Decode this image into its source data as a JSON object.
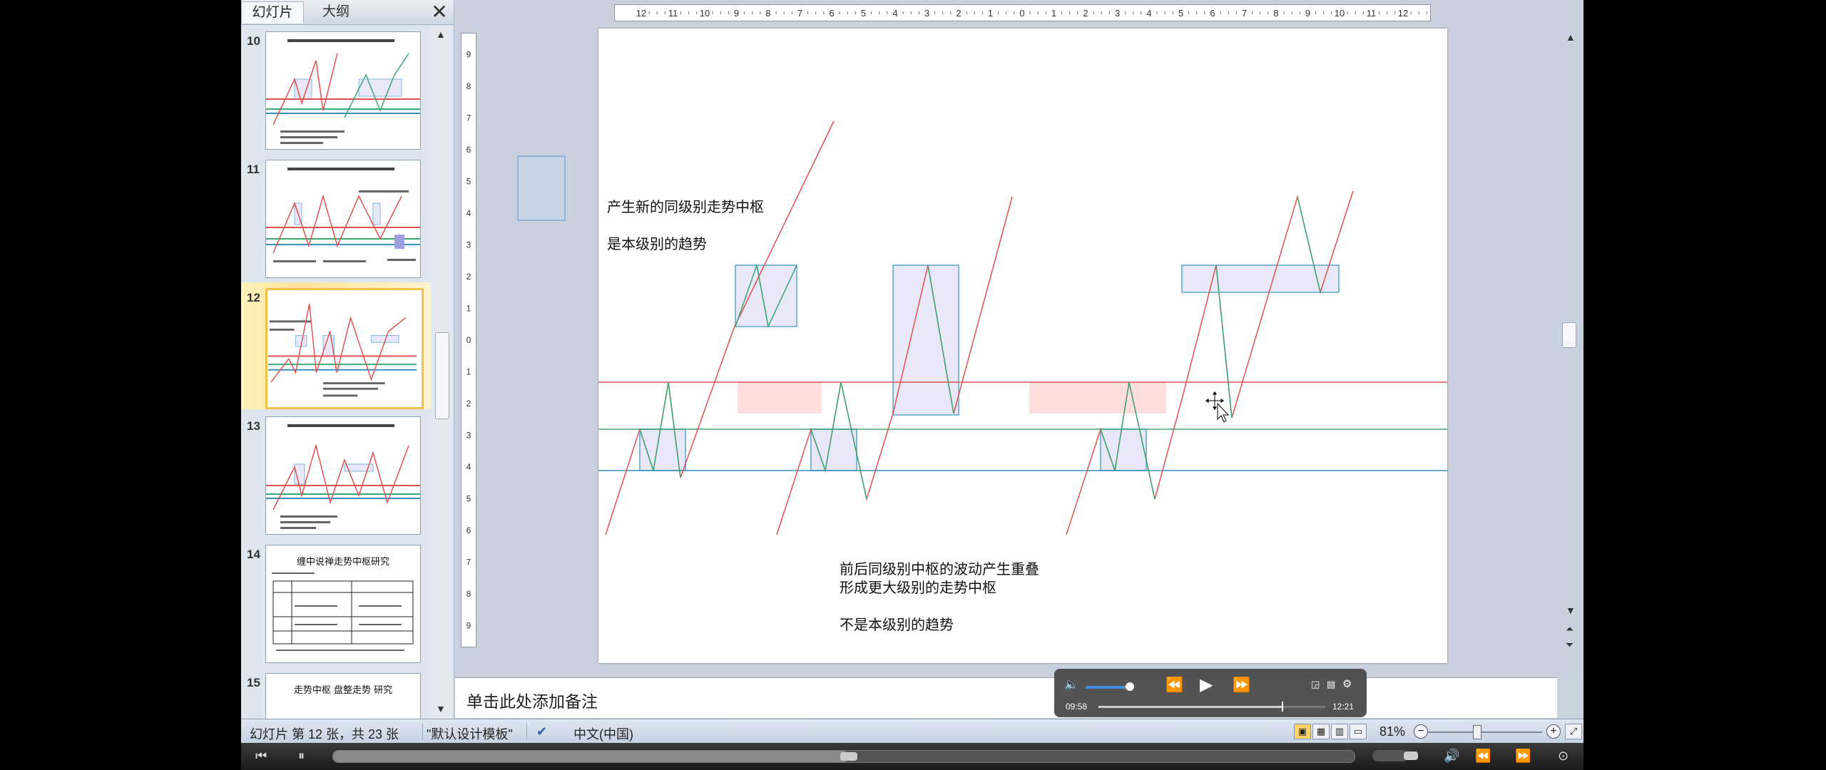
{
  "panel": {
    "tab_slides": "幻灯片",
    "tab_outline": "大纲",
    "close": "✕",
    "thumbnails": [
      {
        "num": "10",
        "selected": false
      },
      {
        "num": "11",
        "selected": false
      },
      {
        "num": "12",
        "selected": true
      },
      {
        "num": "13",
        "selected": false
      },
      {
        "num": "14",
        "selected": false,
        "title": "缠中说禅走势中枢研究"
      },
      {
        "num": "15",
        "selected": false,
        "title": "走势中枢 盘整走势 研究"
      }
    ]
  },
  "slide": {
    "text_top_1": "产生新的同级别走势中枢",
    "text_top_2": "是本级别的趋势",
    "text_bottom_1": "前后同级别中枢的波动产生重叠",
    "text_bottom_2": "形成更大级别的走势中枢",
    "text_bottom_3": "不是本级别的趋势",
    "colors": {
      "red": "#e05050",
      "green": "#3aa874",
      "blue": "#3a8fb8",
      "box_fill": "#e8e8f8",
      "box_border": "#7fb8d8",
      "overlap": "#ffd6d6"
    }
  },
  "notes": {
    "placeholder": "单击此处添加备注"
  },
  "status": {
    "slide_info": "幻灯片 第 12 张，共 23 张",
    "theme": "\"默认设计模板\"",
    "language": "中文(中国)",
    "zoom": "81%"
  },
  "overlay": {
    "elapsed": "09:58",
    "total": "12:21",
    "progress": 0.807,
    "volume": 0.85
  },
  "player": {
    "progress": 0.505
  }
}
